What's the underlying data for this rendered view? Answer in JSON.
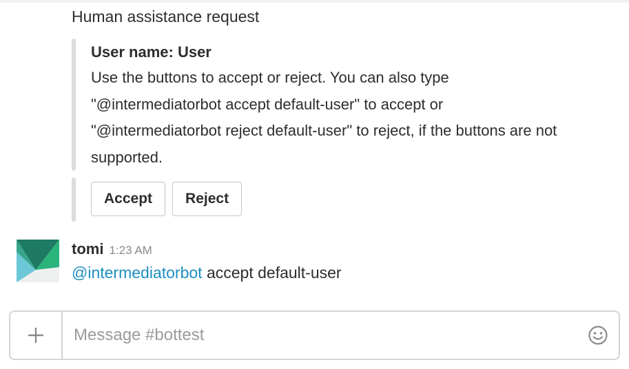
{
  "messages": [
    {
      "text": "Human assistance request"
    },
    {
      "sender": "tomi",
      "time": "1:23 AM",
      "mention": "@intermediatorbot",
      "text": " accept default-user"
    }
  ],
  "attachment": {
    "title": "User name: User",
    "text": "Use the buttons to accept or reject. You can also type \"@intermediatorbot accept default-user\" to accept or \"@intermediatorbot reject default-user\" to reject, if the buttons are not supported.",
    "actions": [
      "Accept",
      "Reject"
    ]
  },
  "composer": {
    "placeholder": "Message #bottest",
    "add_icon": "plus-icon",
    "emoji_icon": "emoji-smiley-icon"
  },
  "colors": {
    "mention": "#1d8ec2",
    "avatar_green": "#2bb47c",
    "avatar_dark": "#1e7a62",
    "avatar_light": "#6cc7d6"
  }
}
